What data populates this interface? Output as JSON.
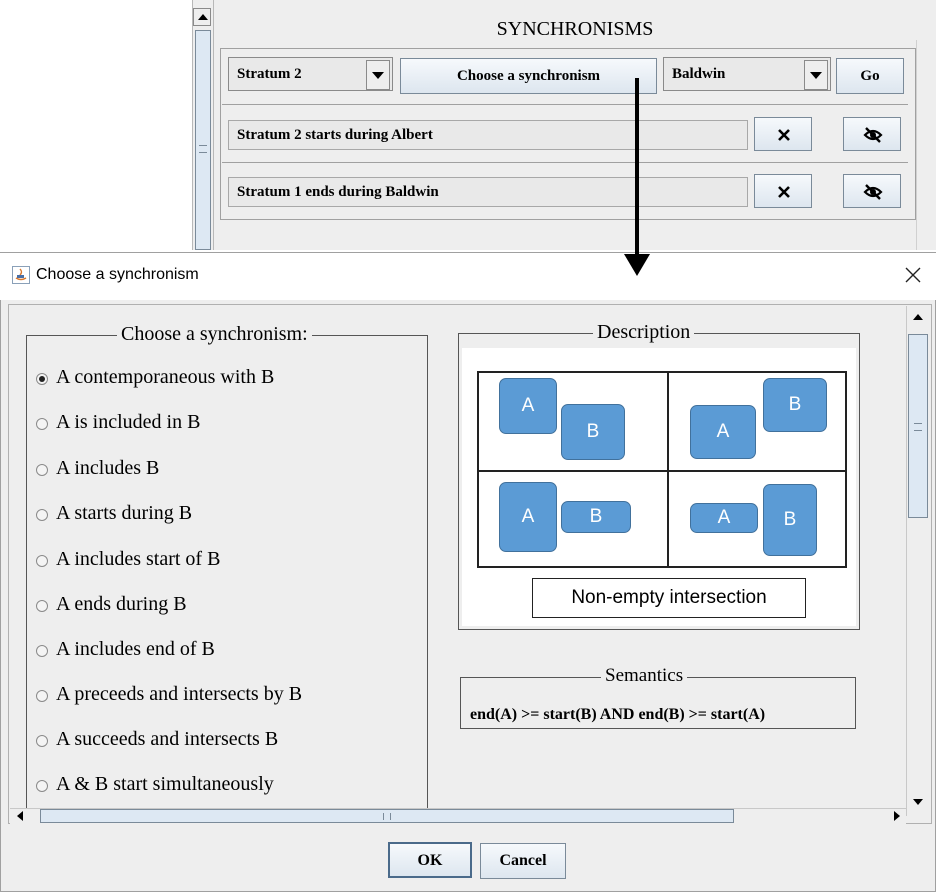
{
  "background_app": {
    "panel_title": "SYNCHRONISMS",
    "combo_left": "Stratum 2",
    "choose_button": "Choose a synchronism",
    "combo_right": "Baldwin",
    "go_button": "Go",
    "rows": [
      {
        "text": "Stratum 2 starts during Albert"
      },
      {
        "text": "Stratum 1 ends during Baldwin"
      }
    ]
  },
  "dialog": {
    "title": "Choose a synchronism",
    "left_group_title": "Choose a synchronism:",
    "options": [
      {
        "label": "A contemporaneous with B",
        "selected": true
      },
      {
        "label": "A is included in B",
        "selected": false
      },
      {
        "label": "A includes B",
        "selected": false
      },
      {
        "label": "A starts during B",
        "selected": false
      },
      {
        "label": "A includes start of B",
        "selected": false
      },
      {
        "label": "A ends during B",
        "selected": false
      },
      {
        "label": "A includes end of B",
        "selected": false
      },
      {
        "label": "A preceeds and intersects by B",
        "selected": false
      },
      {
        "label": "A succeeds and intersects B",
        "selected": false
      },
      {
        "label": "A & B start simultaneously",
        "selected": false
      }
    ],
    "description_title": "Description",
    "diagram_labels": {
      "a": "A",
      "b": "B"
    },
    "description_caption": "Non-empty intersection",
    "semantics_title": "Semantics",
    "semantics_text": "end(A) >= start(B)  AND  end(B) >= start(A)",
    "ok_button": "OK",
    "cancel_button": "Cancel"
  },
  "colors": {
    "block_fill": "#5b9bd5",
    "block_border": "#41719c",
    "panel_bg": "#eeeeee",
    "button_blue": "#dde8f3"
  }
}
